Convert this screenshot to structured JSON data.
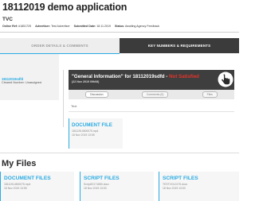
{
  "header": {
    "title": "18112019 demo application",
    "subtitle": "TVC"
  },
  "meta": {
    "online_ref_label": "Online Ref:",
    "online_ref_value": "#1851725",
    "advertiser_label": "Advertiser:",
    "advertiser_value": "Test Advertiser",
    "submitted_label": "Submitted Date:",
    "submitted_value": "18.11.2019",
    "status_label": "Status:",
    "status_value": "Awaiting Agency Feedback"
  },
  "tabs": [
    {
      "label": "ORDER DETAILS & COMMENTS"
    },
    {
      "label": "KEY NUMBERS & REQUIREMENTS"
    }
  ],
  "left_panel": {
    "doc_ref": "18112019sdfd",
    "cleared_number": "Cleared Number: Unassigned"
  },
  "banner": {
    "prefix": "\"General Information\" for 18112019sdfd - ",
    "status": "Not Satisfied",
    "date": "(22 Nov 2019 09h08)"
  },
  "sub_tabs": [
    {
      "label": "Discussion"
    },
    {
      "label": "Comments (0)"
    },
    {
      "label": "Files"
    }
  ],
  "text_label": "Text",
  "document_card": {
    "title": "DOCUMENT FILE",
    "file": "18111914500075.mp4",
    "date": "18 Nov 2019 13:55"
  },
  "my_files": {
    "heading": "My Files",
    "cards": [
      {
        "title": "DOCUMENT FILES",
        "file": "18111914500075.mp4",
        "date": "18 Nov 2019 13:55"
      },
      {
        "title": "SCRIPT FILES",
        "file": "Script20171850.docx",
        "date": "18 Nov 2019 13:53"
      },
      {
        "title": "SCRIPT FILES",
        "file": "TESTVOL0175.docx",
        "date": "18 Nov 2019 13:53"
      }
    ]
  },
  "colors": {
    "accent": "#29abe2",
    "banner_bg": "#3e3e3e",
    "status_red": "#e4342b",
    "active_tab_bg": "#3b3b3b"
  },
  "icons": {
    "banner_pointer": "pointer-hand-icon"
  }
}
